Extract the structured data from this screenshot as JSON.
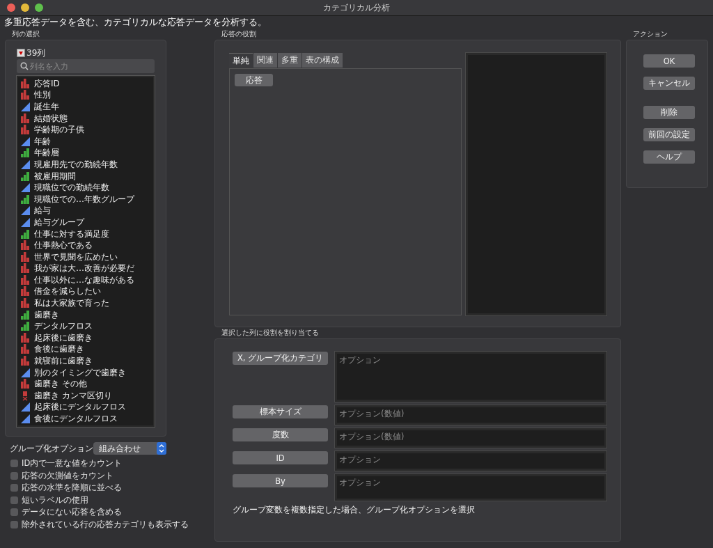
{
  "window": {
    "title": "カテゴリカル分析"
  },
  "description": "多重応答データを含む、カテゴリカルな応答データを分析する。",
  "column_select": {
    "label": "列の選択",
    "count": "39列",
    "search": {
      "placeholder": "列名を入力"
    },
    "columns": [
      {
        "name": "応答ID",
        "kind": "nominal"
      },
      {
        "name": "性別",
        "kind": "nominal"
      },
      {
        "name": "誕生年",
        "kind": "continuous"
      },
      {
        "name": "結婚状態",
        "kind": "nominal"
      },
      {
        "name": "学齢期の子供",
        "kind": "nominal"
      },
      {
        "name": "年齢",
        "kind": "continuous"
      },
      {
        "name": "年齢層",
        "kind": "ordinal"
      },
      {
        "name": "現雇用先での勤続年数",
        "kind": "continuous"
      },
      {
        "name": "被雇用期間",
        "kind": "ordinal"
      },
      {
        "name": "現職位での勤続年数",
        "kind": "continuous"
      },
      {
        "name": "現職位での…年数グループ",
        "kind": "ordinal"
      },
      {
        "name": "給与",
        "kind": "continuous"
      },
      {
        "name": "給与グループ",
        "kind": "continuous"
      },
      {
        "name": "仕事に対する満足度",
        "kind": "ordinal"
      },
      {
        "name": "仕事熱心である",
        "kind": "nominal"
      },
      {
        "name": "世界で見聞を広めたい",
        "kind": "nominal"
      },
      {
        "name": "我が家は大…改善が必要だ",
        "kind": "nominal"
      },
      {
        "name": "仕事以外に…な趣味がある",
        "kind": "nominal"
      },
      {
        "name": "借金を減らしたい",
        "kind": "nominal"
      },
      {
        "name": "私は大家族で育った",
        "kind": "nominal"
      },
      {
        "name": "歯磨き",
        "kind": "ordinal"
      },
      {
        "name": "デンタルフロス",
        "kind": "ordinal"
      },
      {
        "name": "起床後に歯磨き",
        "kind": "nominal"
      },
      {
        "name": "食後に歯磨き",
        "kind": "nominal"
      },
      {
        "name": "就寝前に歯磨き",
        "kind": "nominal"
      },
      {
        "name": "別のタイミングで歯磨き",
        "kind": "continuous"
      },
      {
        "name": "歯磨き その他",
        "kind": "nominal"
      },
      {
        "name": "歯磨き カンマ区切り",
        "kind": "multiple"
      },
      {
        "name": "起床後にデンタルフロス",
        "kind": "continuous"
      },
      {
        "name": "食後にデンタルフロス",
        "kind": "continuous"
      }
    ]
  },
  "grouping_option": {
    "label": "グループ化オプション",
    "value": "組み合わせ"
  },
  "options": [
    {
      "label": "ID内で一意な値をカウント",
      "checked": false
    },
    {
      "label": "応答の欠測値をカウント",
      "checked": false
    },
    {
      "label": "応答の水準を降順に並べる",
      "checked": false
    },
    {
      "label": "短いラベルの使用",
      "checked": false
    },
    {
      "label": "データにない応答を含める",
      "checked": false
    },
    {
      "label": "除外されている行の応答カテゴリも表示する",
      "checked": false
    }
  ],
  "response_roles": {
    "label": "応答の役割",
    "tabs": [
      {
        "label": "単純",
        "selected": true
      },
      {
        "label": "関連",
        "selected": false
      },
      {
        "label": "多重",
        "selected": false
      },
      {
        "label": "表の構成",
        "selected": false
      }
    ],
    "buttons": [
      "応答"
    ]
  },
  "assign_roles": {
    "label": "選択した列に役割を割り当てる",
    "roles": [
      {
        "button": "X, グループ化カテゴリ",
        "placeholder": "オプション",
        "kind": "tall"
      },
      {
        "button": "標本サイズ",
        "placeholder": "オプション(数値)",
        "kind": "short"
      },
      {
        "button": "度数",
        "placeholder": "オプション(数値)",
        "kind": "short"
      },
      {
        "button": "ID",
        "placeholder": "オプション",
        "kind": "short"
      },
      {
        "button": "By",
        "placeholder": "オプション",
        "kind": "medium"
      }
    ],
    "note": "グループ変数を複数指定した場合、グループ化オプションを選択"
  },
  "actions": {
    "label": "アクション",
    "button_groups": [
      [
        "OK",
        "キャンセル"
      ],
      [
        "削除",
        "前回の設定",
        "ヘルプ"
      ]
    ]
  }
}
